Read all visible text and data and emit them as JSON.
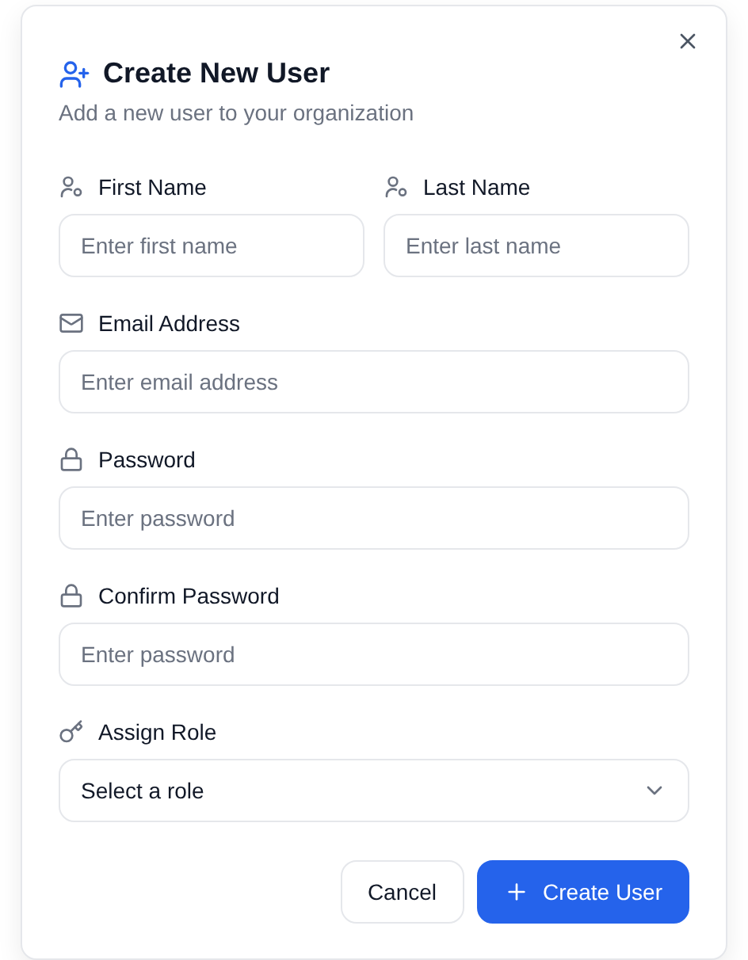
{
  "dialog": {
    "title": "Create New User",
    "subtitle": "Add a new user to your organization"
  },
  "name_fields": [
    {
      "label": "First Name",
      "kind": "person",
      "placeholder": "Enter first name"
    },
    {
      "label": "Last Name",
      "kind": "person",
      "placeholder": "Enter last name"
    }
  ],
  "fields": [
    {
      "label": "Email Address",
      "kind": "email",
      "placeholder": "Enter email address"
    },
    {
      "label": "Password",
      "kind": "password",
      "placeholder": "Enter password"
    },
    {
      "label": "Confirm Password",
      "kind": "password",
      "placeholder": "Enter password"
    },
    {
      "label": "Assign Role",
      "kind": "select",
      "value": "Select a role"
    }
  ],
  "buttons": [
    {
      "label": "Cancel",
      "kind": "secondary"
    },
    {
      "label": "Create User",
      "kind": "primary"
    }
  ]
}
